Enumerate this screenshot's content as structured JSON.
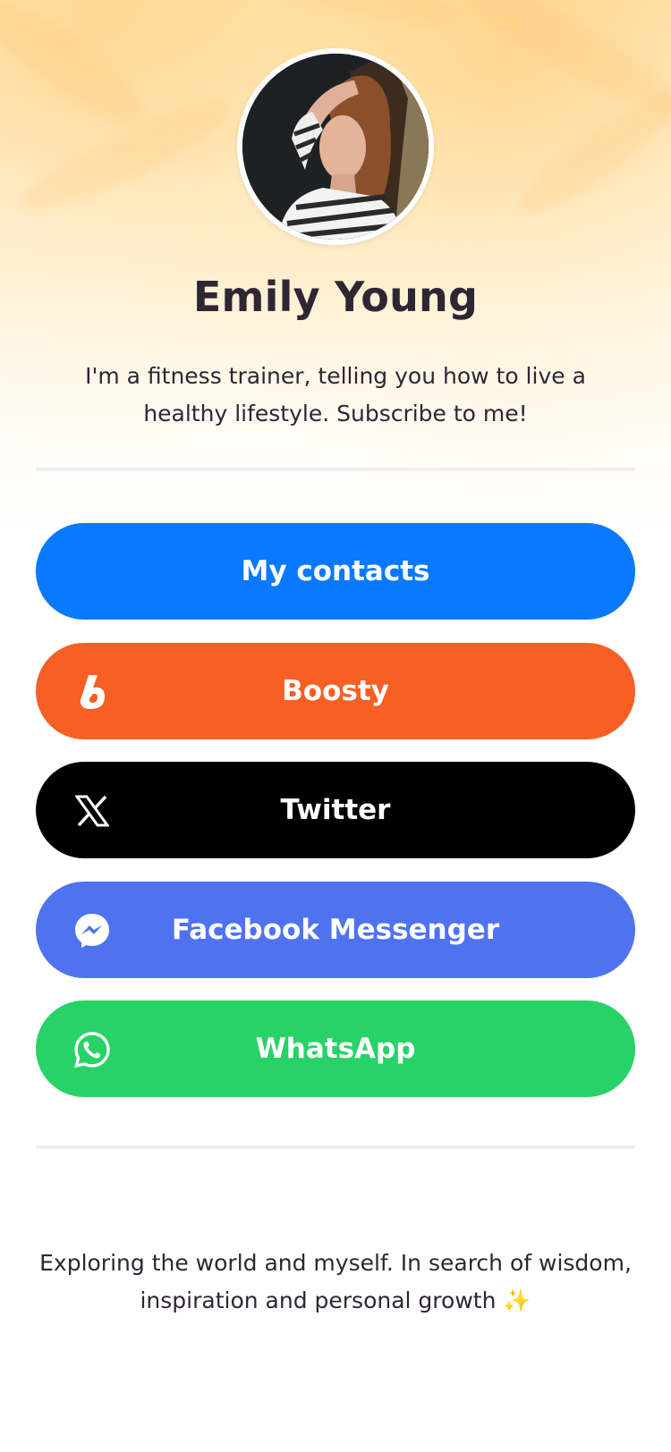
{
  "profile": {
    "name": "Emily Young",
    "bio": "I'm a fitness trainer, telling you how to live a healthy lifestyle. Subscribe to me!"
  },
  "buttons": [
    {
      "label": "My contacts",
      "icon": "",
      "color": "#0a79ff"
    },
    {
      "label": "Boosty",
      "icon": "boosty-icon",
      "color": "#f75f24"
    },
    {
      "label": "Twitter",
      "icon": "x-icon",
      "color": "#000000"
    },
    {
      "label": "Facebook Messenger",
      "icon": "messenger-icon",
      "color": "#4f72f1"
    },
    {
      "label": "WhatsApp",
      "icon": "whatsapp-icon",
      "color": "#27d366"
    }
  ],
  "footer": {
    "text": "Exploring the world and myself. In search of wisdom, inspiration and personal growth",
    "emoji": "✨"
  }
}
